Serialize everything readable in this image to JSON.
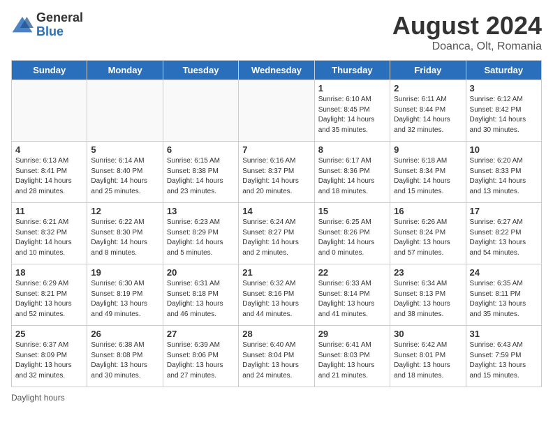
{
  "logo": {
    "general": "General",
    "blue": "Blue"
  },
  "header": {
    "month_year": "August 2024",
    "location": "Doanca, Olt, Romania"
  },
  "weekdays": [
    "Sunday",
    "Monday",
    "Tuesday",
    "Wednesday",
    "Thursday",
    "Friday",
    "Saturday"
  ],
  "weeks": [
    [
      {
        "day": "",
        "info": ""
      },
      {
        "day": "",
        "info": ""
      },
      {
        "day": "",
        "info": ""
      },
      {
        "day": "",
        "info": ""
      },
      {
        "day": "1",
        "info": "Sunrise: 6:10 AM\nSunset: 8:45 PM\nDaylight: 14 hours\nand 35 minutes."
      },
      {
        "day": "2",
        "info": "Sunrise: 6:11 AM\nSunset: 8:44 PM\nDaylight: 14 hours\nand 32 minutes."
      },
      {
        "day": "3",
        "info": "Sunrise: 6:12 AM\nSunset: 8:42 PM\nDaylight: 14 hours\nand 30 minutes."
      }
    ],
    [
      {
        "day": "4",
        "info": "Sunrise: 6:13 AM\nSunset: 8:41 PM\nDaylight: 14 hours\nand 28 minutes."
      },
      {
        "day": "5",
        "info": "Sunrise: 6:14 AM\nSunset: 8:40 PM\nDaylight: 14 hours\nand 25 minutes."
      },
      {
        "day": "6",
        "info": "Sunrise: 6:15 AM\nSunset: 8:38 PM\nDaylight: 14 hours\nand 23 minutes."
      },
      {
        "day": "7",
        "info": "Sunrise: 6:16 AM\nSunset: 8:37 PM\nDaylight: 14 hours\nand 20 minutes."
      },
      {
        "day": "8",
        "info": "Sunrise: 6:17 AM\nSunset: 8:36 PM\nDaylight: 14 hours\nand 18 minutes."
      },
      {
        "day": "9",
        "info": "Sunrise: 6:18 AM\nSunset: 8:34 PM\nDaylight: 14 hours\nand 15 minutes."
      },
      {
        "day": "10",
        "info": "Sunrise: 6:20 AM\nSunset: 8:33 PM\nDaylight: 14 hours\nand 13 minutes."
      }
    ],
    [
      {
        "day": "11",
        "info": "Sunrise: 6:21 AM\nSunset: 8:32 PM\nDaylight: 14 hours\nand 10 minutes."
      },
      {
        "day": "12",
        "info": "Sunrise: 6:22 AM\nSunset: 8:30 PM\nDaylight: 14 hours\nand 8 minutes."
      },
      {
        "day": "13",
        "info": "Sunrise: 6:23 AM\nSunset: 8:29 PM\nDaylight: 14 hours\nand 5 minutes."
      },
      {
        "day": "14",
        "info": "Sunrise: 6:24 AM\nSunset: 8:27 PM\nDaylight: 14 hours\nand 2 minutes."
      },
      {
        "day": "15",
        "info": "Sunrise: 6:25 AM\nSunset: 8:26 PM\nDaylight: 14 hours\nand 0 minutes."
      },
      {
        "day": "16",
        "info": "Sunrise: 6:26 AM\nSunset: 8:24 PM\nDaylight: 13 hours\nand 57 minutes."
      },
      {
        "day": "17",
        "info": "Sunrise: 6:27 AM\nSunset: 8:22 PM\nDaylight: 13 hours\nand 54 minutes."
      }
    ],
    [
      {
        "day": "18",
        "info": "Sunrise: 6:29 AM\nSunset: 8:21 PM\nDaylight: 13 hours\nand 52 minutes."
      },
      {
        "day": "19",
        "info": "Sunrise: 6:30 AM\nSunset: 8:19 PM\nDaylight: 13 hours\nand 49 minutes."
      },
      {
        "day": "20",
        "info": "Sunrise: 6:31 AM\nSunset: 8:18 PM\nDaylight: 13 hours\nand 46 minutes."
      },
      {
        "day": "21",
        "info": "Sunrise: 6:32 AM\nSunset: 8:16 PM\nDaylight: 13 hours\nand 44 minutes."
      },
      {
        "day": "22",
        "info": "Sunrise: 6:33 AM\nSunset: 8:14 PM\nDaylight: 13 hours\nand 41 minutes."
      },
      {
        "day": "23",
        "info": "Sunrise: 6:34 AM\nSunset: 8:13 PM\nDaylight: 13 hours\nand 38 minutes."
      },
      {
        "day": "24",
        "info": "Sunrise: 6:35 AM\nSunset: 8:11 PM\nDaylight: 13 hours\nand 35 minutes."
      }
    ],
    [
      {
        "day": "25",
        "info": "Sunrise: 6:37 AM\nSunset: 8:09 PM\nDaylight: 13 hours\nand 32 minutes."
      },
      {
        "day": "26",
        "info": "Sunrise: 6:38 AM\nSunset: 8:08 PM\nDaylight: 13 hours\nand 30 minutes."
      },
      {
        "day": "27",
        "info": "Sunrise: 6:39 AM\nSunset: 8:06 PM\nDaylight: 13 hours\nand 27 minutes."
      },
      {
        "day": "28",
        "info": "Sunrise: 6:40 AM\nSunset: 8:04 PM\nDaylight: 13 hours\nand 24 minutes."
      },
      {
        "day": "29",
        "info": "Sunrise: 6:41 AM\nSunset: 8:03 PM\nDaylight: 13 hours\nand 21 minutes."
      },
      {
        "day": "30",
        "info": "Sunrise: 6:42 AM\nSunset: 8:01 PM\nDaylight: 13 hours\nand 18 minutes."
      },
      {
        "day": "31",
        "info": "Sunrise: 6:43 AM\nSunset: 7:59 PM\nDaylight: 13 hours\nand 15 minutes."
      }
    ]
  ],
  "footer": {
    "note": "Daylight hours"
  }
}
